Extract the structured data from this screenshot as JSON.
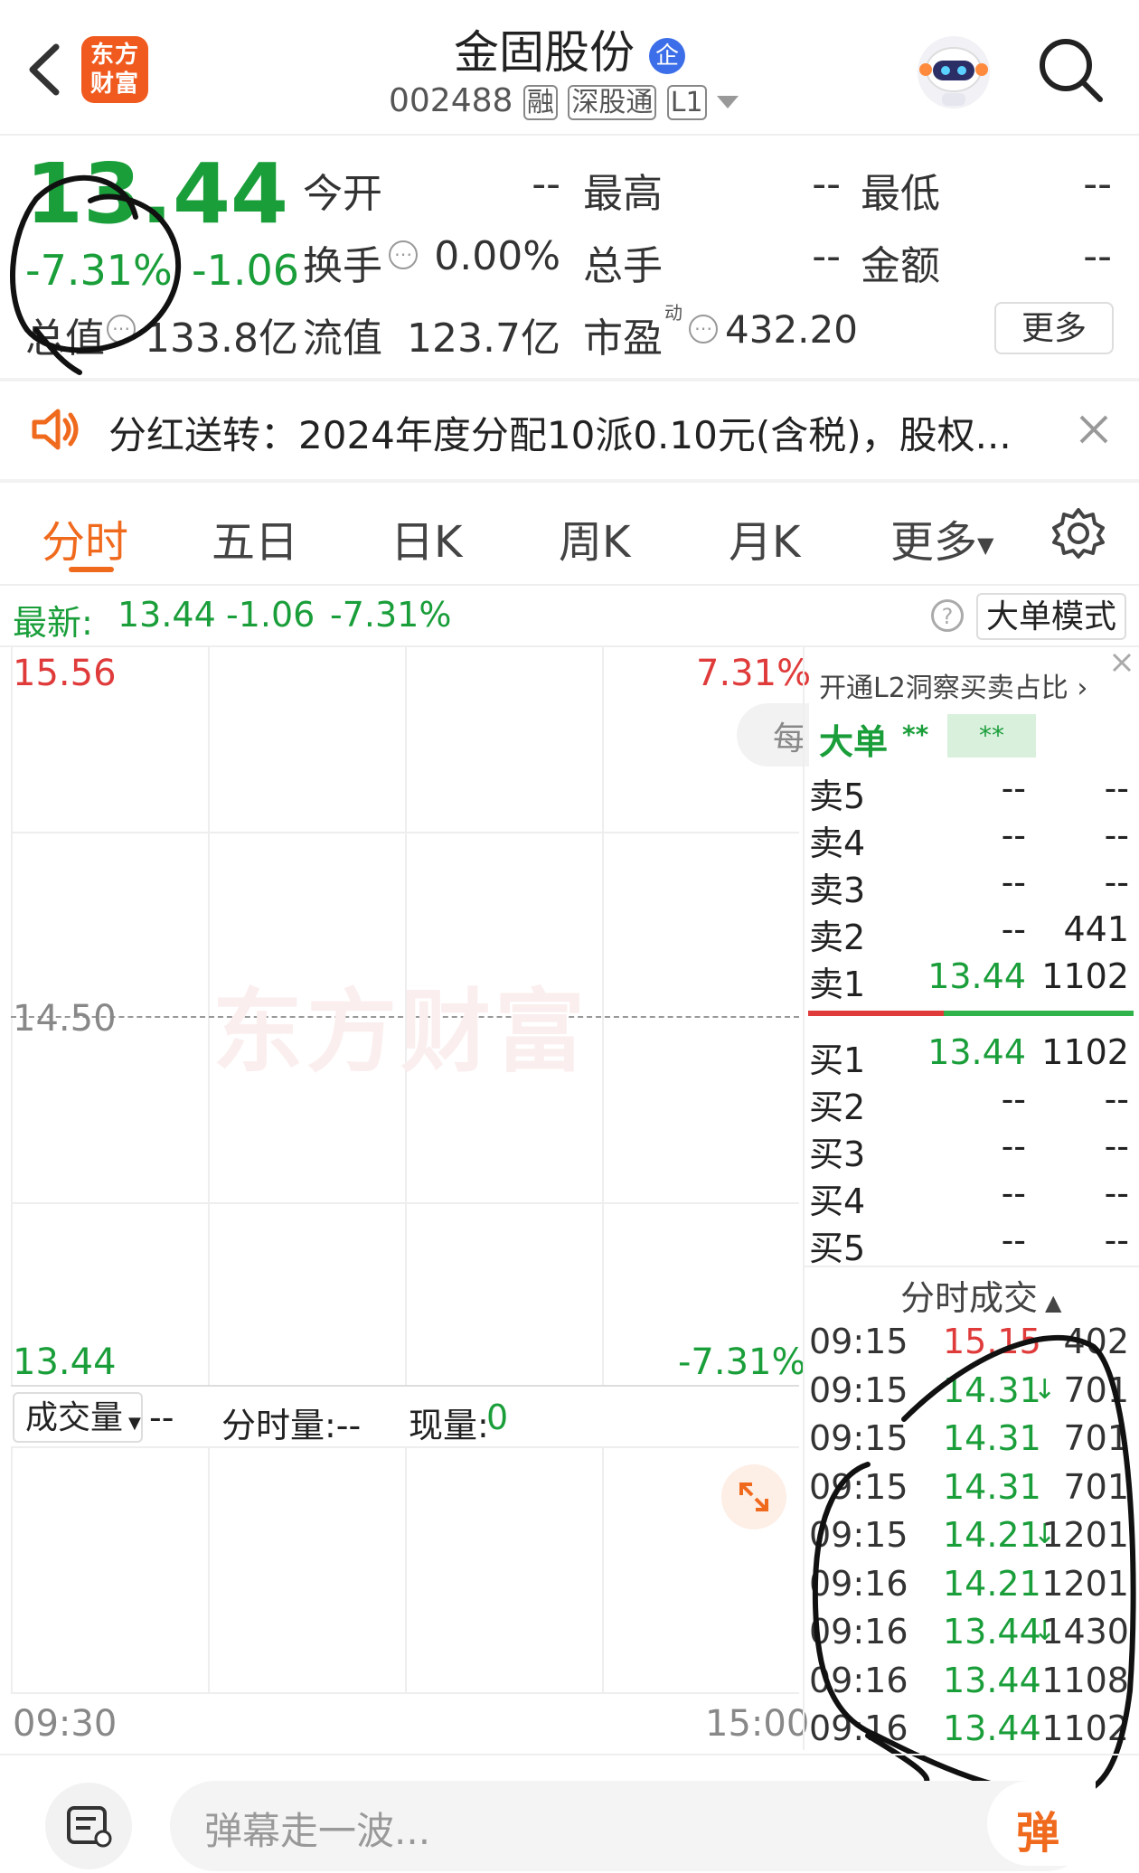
{
  "header": {
    "app_logo_text": "东方财富",
    "stock_name": "金固股份",
    "enterprise_badge": "企",
    "code": "002488",
    "tags": [
      "融",
      "深股通",
      "L1"
    ]
  },
  "quote": {
    "price": "13.44",
    "change_pct": "-7.31%",
    "change": "-1.06",
    "total_value_label": "总值",
    "total_value": "133.8亿",
    "fields": [
      {
        "label": "今开",
        "value": "--"
      },
      {
        "label": "最高",
        "value": "--"
      },
      {
        "label": "最低",
        "value": "--"
      },
      {
        "label": "换手",
        "value": "0.00%"
      },
      {
        "label": "总手",
        "value": "--"
      },
      {
        "label": "金额",
        "value": "--"
      }
    ],
    "float_value_label": "流值",
    "float_value": "123.7亿",
    "pe_label": "市盈",
    "pe_sup": "动",
    "pe_value": "432.20",
    "more_button": "更多"
  },
  "notice": {
    "text": "分红送转：2024年度分配10派0.10元(含税)，股权..."
  },
  "tabs": [
    {
      "label": "分时",
      "active": true
    },
    {
      "label": "五日"
    },
    {
      "label": "日K"
    },
    {
      "label": "周K"
    },
    {
      "label": "月K"
    },
    {
      "label": "更多"
    }
  ],
  "latest_bar": {
    "label": "最新:",
    "price": "13.44",
    "change": "-1.06",
    "pct": "-7.31%",
    "big_order_mode": "大单模式"
  },
  "chart": {
    "y_top": "15.56",
    "y_mid": "14.50",
    "y_bottom": "13.44",
    "pct_top": "7.31%",
    "pct_bottom": "-7.31%",
    "side_tab": "每",
    "watermark": "东方财富",
    "time_start": "09:30",
    "time_end": "15:00",
    "volume_selector": "成交量",
    "volume_value": "--",
    "minute_volume": "分时量:--",
    "current_volume_label": "现量:",
    "current_volume_value": "0"
  },
  "orderbook": {
    "promo": "开通L2洞察买卖占比",
    "big_order_label": "大单",
    "big_order_v1": "**",
    "big_order_v2": "**",
    "asks": [
      {
        "label": "卖5",
        "price": "--",
        "vol": "--"
      },
      {
        "label": "卖4",
        "price": "--",
        "vol": "--"
      },
      {
        "label": "卖3",
        "price": "--",
        "vol": "--"
      },
      {
        "label": "卖2",
        "price": "--",
        "vol": "441"
      },
      {
        "label": "卖1",
        "price": "13.44",
        "vol": "1102"
      }
    ],
    "bids": [
      {
        "label": "买1",
        "price": "13.44",
        "vol": "1102"
      },
      {
        "label": "买2",
        "price": "--",
        "vol": "--"
      },
      {
        "label": "买3",
        "price": "--",
        "vol": "--"
      },
      {
        "label": "买4",
        "price": "--",
        "vol": "--"
      },
      {
        "label": "买5",
        "price": "--",
        "vol": "--"
      }
    ],
    "ticks_title": "分时成交",
    "ticks": [
      {
        "time": "09:15",
        "price": "15.15",
        "vol": "402",
        "color": "red",
        "arrow": ""
      },
      {
        "time": "09:15",
        "price": "14.31",
        "vol": "701",
        "color": "green",
        "arrow": "↓"
      },
      {
        "time": "09:15",
        "price": "14.31",
        "vol": "701",
        "color": "green",
        "arrow": ""
      },
      {
        "time": "09:15",
        "price": "14.31",
        "vol": "701",
        "color": "green",
        "arrow": ""
      },
      {
        "time": "09:15",
        "price": "14.21",
        "vol": "1201",
        "color": "green",
        "arrow": "↓"
      },
      {
        "time": "09:16",
        "price": "14.21",
        "vol": "1201",
        "color": "green",
        "arrow": ""
      },
      {
        "time": "09:16",
        "price": "13.44",
        "vol": "1430",
        "color": "green",
        "arrow": "↓"
      },
      {
        "time": "09:16",
        "price": "13.44",
        "vol": "1108",
        "color": "green",
        "arrow": ""
      },
      {
        "time": "09:16",
        "price": "13.44",
        "vol": "1102",
        "color": "green",
        "arrow": ""
      }
    ]
  },
  "bottom": {
    "danmu_placeholder": "弹幕走一波...",
    "danmu_button": "弹"
  },
  "colors": {
    "up": "#e03b3b",
    "down": "#1a9e3a",
    "accent": "#f06a1e"
  }
}
